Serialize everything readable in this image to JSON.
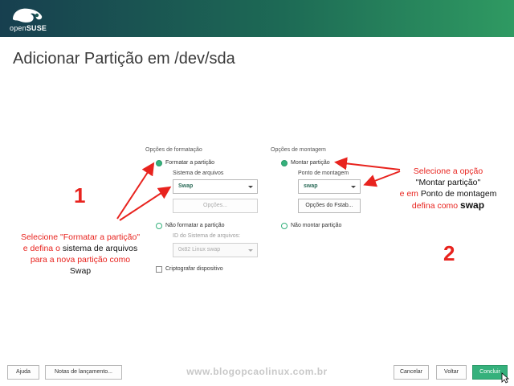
{
  "header": {
    "logo_text_light": "open",
    "logo_text_bold": "SUSE"
  },
  "page_title": "Adicionar Partição em /dev/sda",
  "format_options": {
    "group_label": "Opções de formatação",
    "format_radio_label": "Formatar a partição",
    "filesystem_label": "Sistema de arquivos",
    "filesystem_value": "Swap",
    "options_button": "Opções...",
    "no_format_radio_label": "Não formatar a partição",
    "fs_id_label": "ID do Sistema de arquivos:",
    "fs_id_value": "0x82 Linux swap",
    "encrypt_label": "Criptografar dispositivo"
  },
  "mount_options": {
    "group_label": "Opções de montagem",
    "mount_radio_label": "Montar partição",
    "mount_point_label": "Ponto de montagem",
    "mount_point_value": "swap",
    "fstab_button": "Opções do Fstab...",
    "no_mount_radio_label": "Não montar partição"
  },
  "annotations": {
    "number_1": "1",
    "number_2": "2",
    "left_line1": "Selecione  \"Formatar a partição\"",
    "left_line2_red_a": "e defina o",
    "left_line2_black": "sistema de arquivos",
    "left_line3": "para a nova partição como",
    "left_line4": "Swap",
    "right_line1": "Selecione  a opção",
    "right_line2": "\"Montar partição\"",
    "right_line3_red": "e em",
    "right_line3_black": "Ponto de montagem",
    "right_line4_red": "defina como",
    "right_line4_bold": "swap"
  },
  "footer": {
    "help": "Ajuda",
    "release_notes": "Notas de lançamento...",
    "watermark": "www.blogopcaolinux.com.br",
    "cancel": "Cancelar",
    "back": "Voltar",
    "finish": "Concluir"
  },
  "colors": {
    "accent": "#35b17c",
    "annotation_red": "#e8231e",
    "header_dark": "#173f4f"
  }
}
